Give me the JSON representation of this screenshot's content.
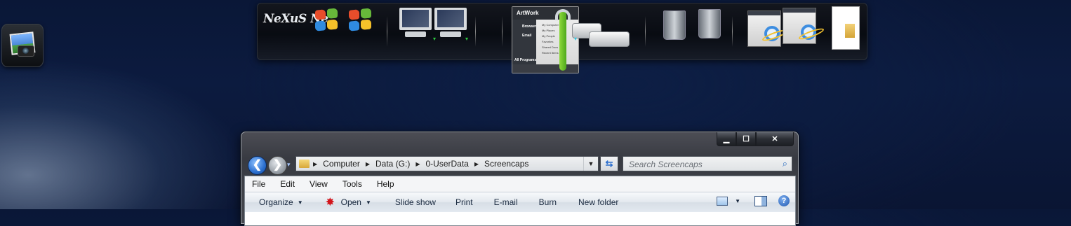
{
  "desktop": {
    "icon_name": "photo-viewer-icon"
  },
  "dock": {
    "logo_text": "NeXuS Ne",
    "artwork": {
      "title": "ArtWork",
      "left_items": [
        "Browser",
        "Email"
      ],
      "list_items": [
        "My Computer",
        "My Places",
        "My People",
        "Favorites",
        "Shared Docs",
        "Recent Items"
      ],
      "footer": "All Programs"
    },
    "icons": [
      "nexus-logo-icon",
      "windows-flag-icon",
      "windows-flag-icon",
      "monitor-icon",
      "monitor-icon",
      "artwork-menu-icon",
      "wrench-icon",
      "hard-drive-icon",
      "hard-drive-icon",
      "recycle-bin-empty-icon",
      "recycle-bin-full-icon",
      "window-thumbnail-icon",
      "internet-explorer-icon",
      "window-thumbnail-icon",
      "internet-explorer-icon",
      "folder-window-icon"
    ]
  },
  "explorer": {
    "caption": {
      "minimize": "▁",
      "maximize": "☐",
      "close": "✕"
    },
    "nav": {
      "back": "❮",
      "forward": "❯",
      "recent": "▾"
    },
    "address": {
      "crumbs": [
        "Computer",
        "Data (G:)",
        "0-UserData",
        "Screencaps"
      ],
      "separator": "▶",
      "dropdown": "▼"
    },
    "refresh": "⇆",
    "search": {
      "placeholder": "Search Screencaps",
      "icon": "⌕"
    },
    "menu": [
      "File",
      "Edit",
      "View",
      "Tools",
      "Help"
    ],
    "commands": {
      "organize": "Organize",
      "open": "Open",
      "slideshow": "Slide show",
      "print": "Print",
      "email": "E-mail",
      "burn": "Burn",
      "new_folder": "New folder",
      "caret": "▼",
      "help": "?"
    }
  }
}
